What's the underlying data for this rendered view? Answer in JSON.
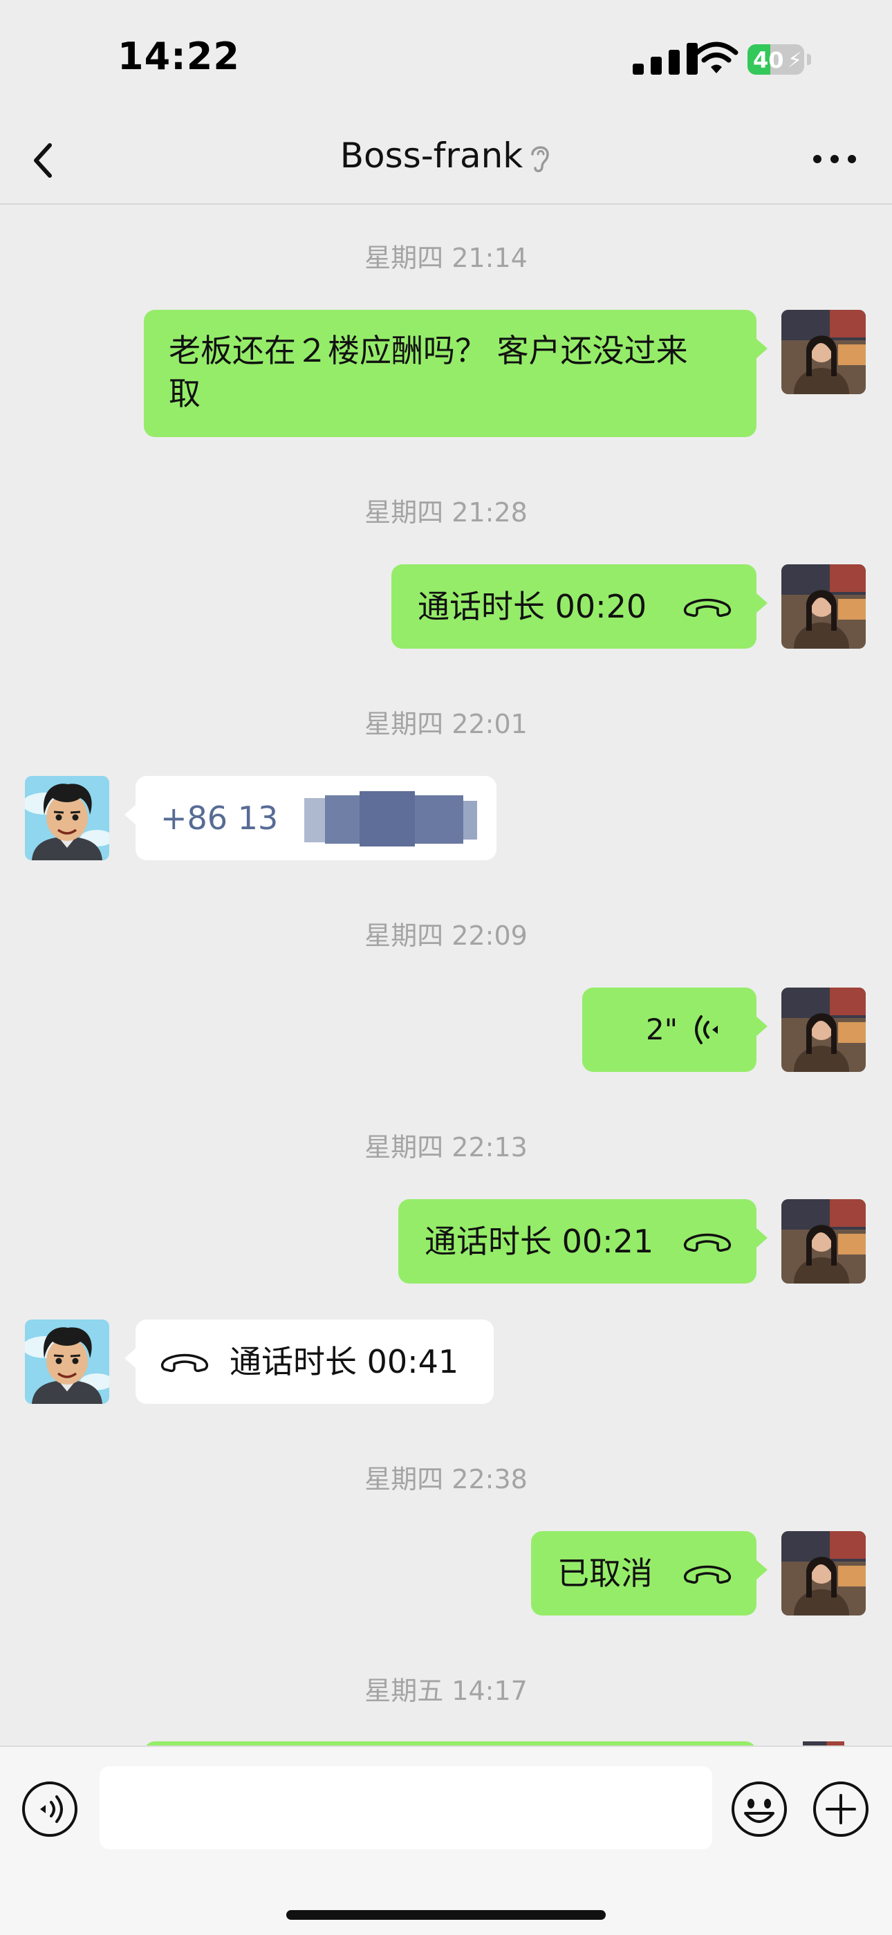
{
  "status_bar": {
    "time": "14:22",
    "battery_text": "40",
    "battery_level": 0.4
  },
  "nav": {
    "title": "Boss-frank"
  },
  "messages": {
    "ts1": "星期四 21:14",
    "m1_line1": "老板还在２楼应酬吗？ 客户还没过来",
    "m1_line2": "取",
    "ts2": "星期四 21:28",
    "m2": "通话时长 00:20",
    "ts3": "星期四 22:01",
    "m3": "+86 13",
    "ts4": "星期四 22:09",
    "m4": "2\"",
    "ts5": "星期四 22:13",
    "m5": "通话时长 00:21",
    "m6": "通话时长 00:41",
    "ts6": "星期四 22:38",
    "m7": "已取消",
    "ts7": "星期五 14:17"
  },
  "input": {
    "placeholder": ""
  },
  "colors": {
    "bubble_me": "#95ec69",
    "bubble_other": "#ffffff",
    "background": "#ededed",
    "link_blue": "#576b95"
  }
}
